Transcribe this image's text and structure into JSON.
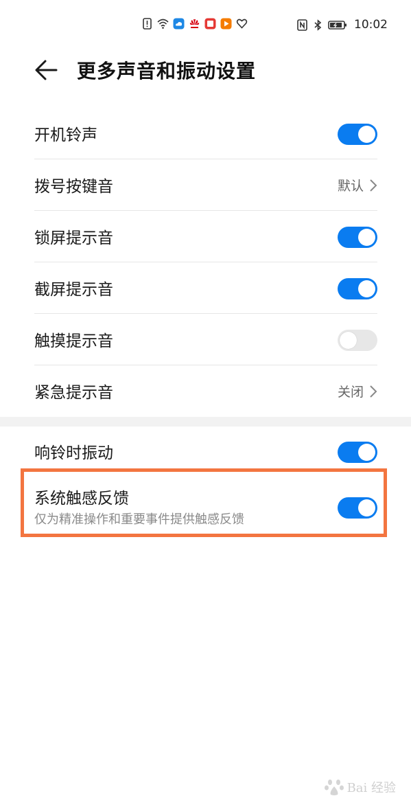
{
  "status_bar": {
    "time": "10:02",
    "left_icons": [
      "alert-icon",
      "wifi-icon",
      "cloud-app-icon",
      "huawei-icon",
      "app-red-icon",
      "video-app-icon",
      "heart-icon"
    ],
    "right_icons": [
      "nfc-icon",
      "bluetooth-icon",
      "battery-icon"
    ]
  },
  "header": {
    "title": "更多声音和振动设置",
    "back_icon": "arrow-left-icon"
  },
  "settings": [
    {
      "label": "开机铃声",
      "control": "toggle",
      "state": "on"
    },
    {
      "label": "拨号按键音",
      "control": "link",
      "value": "默认"
    },
    {
      "label": "锁屏提示音",
      "control": "toggle",
      "state": "on"
    },
    {
      "label": "截屏提示音",
      "control": "toggle",
      "state": "on"
    },
    {
      "label": "触摸提示音",
      "control": "toggle",
      "state": "off"
    },
    {
      "label": "紧急提示音",
      "control": "link",
      "value": "关闭"
    },
    {
      "label": "响铃时振动",
      "control": "toggle",
      "state": "on"
    },
    {
      "label": "系统触感反馈",
      "sublabel": "仅为精准操作和重要事件提供触感反馈",
      "control": "toggle",
      "state": "on",
      "highlighted": true
    }
  ],
  "watermark": {
    "text": "Bai 经验",
    "brand": "Baidu"
  },
  "colors": {
    "accent": "#0a7cf0",
    "toggle_off": "#e7e7e7",
    "highlight_border": "#f37540",
    "section_gap": "#f2f2f2"
  }
}
